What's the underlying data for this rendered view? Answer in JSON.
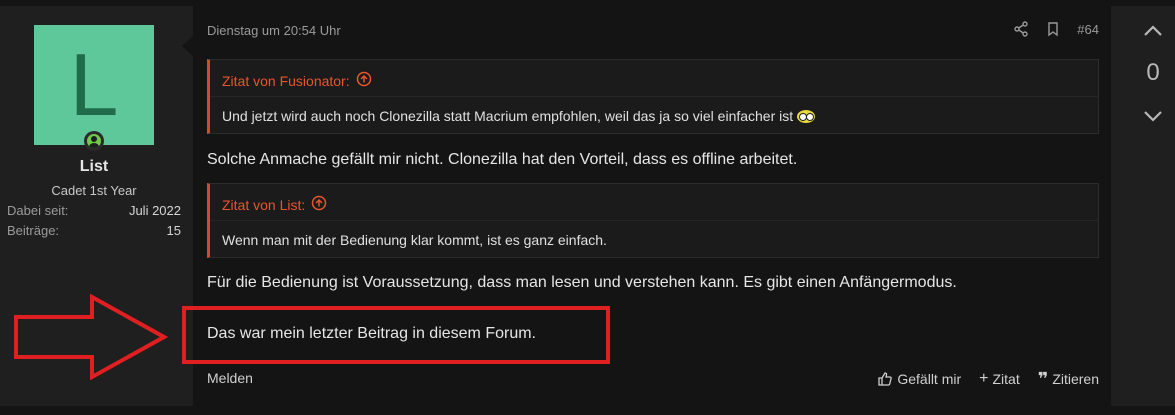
{
  "user": {
    "avatar_letter": "L",
    "name": "List",
    "title": "Cadet 1st Year",
    "stats": [
      {
        "label": "Dabei seit:",
        "value": "Juli 2022"
      },
      {
        "label": "Beiträge:",
        "value": "15"
      }
    ]
  },
  "post": {
    "date": "Dienstag um 20:54 Uhr",
    "number": "#64",
    "quote1": {
      "header": "Zitat von Fusionator:",
      "text": "Und jetzt wird auch noch Clonezilla statt Macrium empfohlen, weil das ja so viel einfacher ist"
    },
    "para1": "Solche Anmache gefällt mir nicht. Clonezilla hat den Vorteil, dass es offline arbeitet.",
    "quote2": {
      "header": "Zitat von List:",
      "text": "Wenn man mit der Bedienung klar kommt, ist es ganz einfach."
    },
    "para2": "Für die Bedienung ist Voraussetzung, dass man lesen und verstehen kann. Es gibt einen Anfängermodus.",
    "para3": "Das war mein letzter Beitrag in diesem Forum.",
    "footer": {
      "report": "Melden",
      "like": "Gefällt mir",
      "add_quote": "Zitat",
      "quote": "Zitieren"
    }
  },
  "votes": {
    "count": "0"
  },
  "colors": {
    "accent": "#e8552f",
    "highlight": "#e02020",
    "avatar_bg": "#5ec89a"
  }
}
